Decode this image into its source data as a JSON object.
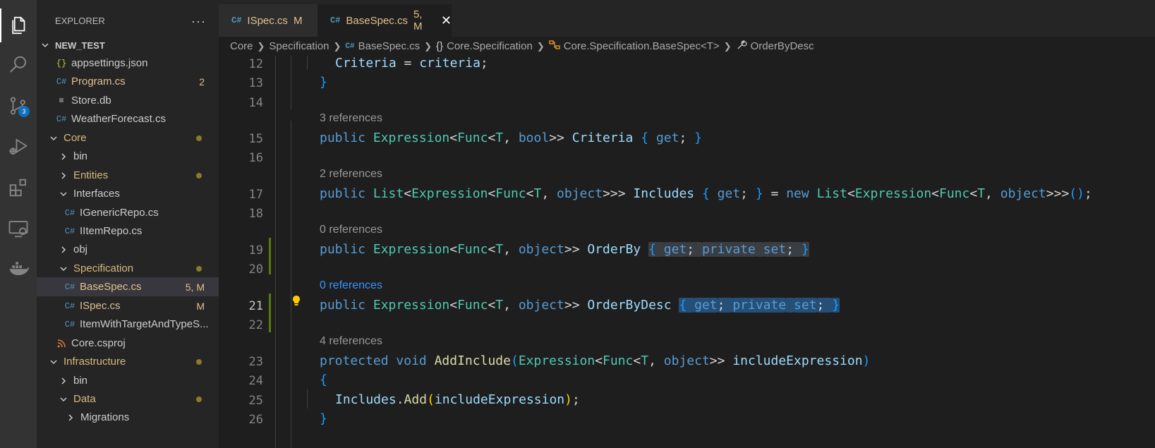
{
  "activity_bar": {
    "icons": [
      "files-icon",
      "search-icon",
      "source-control-icon",
      "run-debug-icon",
      "extensions-icon",
      "remote-explorer-icon",
      "docker-icon"
    ],
    "source_control_badge": "3"
  },
  "sidebar": {
    "title": "EXPLORER",
    "project": "NEW_TEST",
    "items": [
      {
        "label": "appsettings.json",
        "icon": "{}",
        "decoration": ""
      },
      {
        "label": "Program.cs",
        "icon": "C#",
        "decoration": "2"
      },
      {
        "label": "Store.db",
        "icon": "≡",
        "decoration": ""
      },
      {
        "label": "WeatherForecast.cs",
        "icon": "C#",
        "decoration": ""
      },
      {
        "label": "Core",
        "decoration": ""
      },
      {
        "label": "bin",
        "decoration": ""
      },
      {
        "label": "Entities",
        "decoration": ""
      },
      {
        "label": "Interfaces",
        "decoration": ""
      },
      {
        "label": "IGenericRepo.cs",
        "icon": "C#",
        "decoration": ""
      },
      {
        "label": "IItemRepo.cs",
        "icon": "C#",
        "decoration": ""
      },
      {
        "label": "obj",
        "decoration": ""
      },
      {
        "label": "Specification",
        "decoration": ""
      },
      {
        "label": "BaseSpec.cs",
        "icon": "C#",
        "decoration": "5, M"
      },
      {
        "label": "ISpec.cs",
        "icon": "C#",
        "decoration": "M"
      },
      {
        "label": "ItemWithTargetAndTypeS...",
        "icon": "C#",
        "decoration": ""
      },
      {
        "label": "Core.csproj",
        "icon": "rss",
        "decoration": ""
      },
      {
        "label": "Infrastructure",
        "decoration": ""
      },
      {
        "label": "bin",
        "decoration": ""
      },
      {
        "label": "Data",
        "decoration": ""
      },
      {
        "label": "Migrations",
        "decoration": ""
      }
    ]
  },
  "tabs": [
    {
      "label": "ISpec.cs",
      "state": "M"
    },
    {
      "label": "BaseSpec.cs",
      "state": "5, M",
      "close": "✕"
    }
  ],
  "breadcrumb": [
    "Core",
    "Specification",
    "BaseSpec.cs",
    "Core.Specification",
    "Core.Specification.BaseSpec<T>",
    "OrderByDesc"
  ],
  "editor": {
    "line_numbers": [
      "12",
      "13",
      "14",
      "15",
      "16",
      "17",
      "18",
      "19",
      "20",
      "21",
      "22",
      "23",
      "24",
      "25",
      "26"
    ],
    "codelens": [
      "3 references",
      "2 references",
      "0 references",
      "0 references",
      "4 references"
    ],
    "lines": [
      {
        "tokens": [
          [
            "id",
            "Criteria"
          ],
          [
            "pl",
            " = "
          ],
          [
            "id",
            "criteria"
          ],
          [
            "pl",
            ";"
          ]
        ]
      },
      {
        "tokens": [
          [
            "br3",
            "}"
          ]
        ]
      },
      {
        "tokens": []
      },
      {
        "tokens": [
          [
            "kw",
            "public"
          ],
          [
            "pl",
            " "
          ],
          [
            "ty",
            "Expression"
          ],
          [
            "pl",
            "<"
          ],
          [
            "ty",
            "Func"
          ],
          [
            "pl",
            "<"
          ],
          [
            "ty",
            "T"
          ],
          [
            "pl",
            ", "
          ],
          [
            "kw",
            "bool"
          ],
          [
            "pl",
            ">> "
          ],
          [
            "id",
            "Criteria"
          ],
          [
            "pl",
            " "
          ],
          [
            "br3",
            "{"
          ],
          [
            "pl",
            " "
          ],
          [
            "kw",
            "get"
          ],
          [
            "pl",
            "; "
          ],
          [
            "br3",
            "}"
          ]
        ]
      },
      {
        "tokens": []
      },
      {
        "tokens": [
          [
            "kw",
            "public"
          ],
          [
            "pl",
            " "
          ],
          [
            "ty",
            "List"
          ],
          [
            "pl",
            "<"
          ],
          [
            "ty",
            "Expression"
          ],
          [
            "pl",
            "<"
          ],
          [
            "ty",
            "Func"
          ],
          [
            "pl",
            "<"
          ],
          [
            "ty",
            "T"
          ],
          [
            "pl",
            ", "
          ],
          [
            "kw",
            "object"
          ],
          [
            "pl",
            ">>> "
          ],
          [
            "id",
            "Includes"
          ],
          [
            "pl",
            " "
          ],
          [
            "br3",
            "{"
          ],
          [
            "pl",
            " "
          ],
          [
            "kw",
            "get"
          ],
          [
            "pl",
            "; "
          ],
          [
            "br3",
            "}"
          ],
          [
            "pl",
            " = "
          ],
          [
            "kw",
            "new"
          ],
          [
            "pl",
            " "
          ],
          [
            "ty",
            "List"
          ],
          [
            "pl",
            "<"
          ],
          [
            "ty",
            "Expression"
          ],
          [
            "pl",
            "<"
          ],
          [
            "ty",
            "Func"
          ],
          [
            "pl",
            "<"
          ],
          [
            "ty",
            "T"
          ],
          [
            "pl",
            ", "
          ],
          [
            "kw",
            "object"
          ],
          [
            "pl",
            ">>>"
          ],
          [
            "br3",
            "()"
          ],
          [
            "pl",
            ";"
          ]
        ]
      },
      {
        "tokens": []
      },
      {
        "tokens": [
          [
            "kw",
            "public"
          ],
          [
            "pl",
            " "
          ],
          [
            "ty",
            "Expression"
          ],
          [
            "pl",
            "<"
          ],
          [
            "ty",
            "Func"
          ],
          [
            "pl",
            "<"
          ],
          [
            "ty",
            "T"
          ],
          [
            "pl",
            ", "
          ],
          [
            "kw",
            "object"
          ],
          [
            "pl",
            ">> "
          ],
          [
            "id",
            "OrderBy"
          ],
          [
            "pl",
            " "
          ],
          [
            "sel-br3",
            "{ "
          ],
          [
            "sel-kw",
            "get"
          ],
          [
            "sel-pl",
            "; "
          ],
          [
            "sel-kw",
            "private"
          ],
          [
            "sel-pl",
            " "
          ],
          [
            "sel-kw",
            "set"
          ],
          [
            "sel-pl",
            "; "
          ],
          [
            "sel-br3",
            "}"
          ]
        ]
      },
      {
        "tokens": []
      },
      {
        "tokens": [
          [
            "kw",
            "public"
          ],
          [
            "pl",
            " "
          ],
          [
            "ty",
            "Expression"
          ],
          [
            "pl",
            "<"
          ],
          [
            "ty",
            "Func"
          ],
          [
            "pl",
            "<"
          ],
          [
            "ty",
            "T"
          ],
          [
            "pl",
            ", "
          ],
          [
            "kw",
            "object"
          ],
          [
            "pl",
            ">> "
          ],
          [
            "id",
            "OrderByDesc"
          ],
          [
            "pl",
            " "
          ],
          [
            "sel2-br3",
            "{ "
          ],
          [
            "sel2-kw",
            "get"
          ],
          [
            "sel2-pl",
            "; "
          ],
          [
            "sel2-kw",
            "private"
          ],
          [
            "sel2-pl",
            " "
          ],
          [
            "sel2-kw",
            "set"
          ],
          [
            "sel2-pl",
            "; "
          ],
          [
            "sel2-br3",
            "}"
          ]
        ]
      },
      {
        "tokens": []
      },
      {
        "tokens": [
          [
            "kw",
            "protected"
          ],
          [
            "pl",
            " "
          ],
          [
            "kw",
            "void"
          ],
          [
            "pl",
            " "
          ],
          [
            "fn",
            "AddInclude"
          ],
          [
            "br3",
            "("
          ],
          [
            "ty",
            "Expression"
          ],
          [
            "pl",
            "<"
          ],
          [
            "ty",
            "Func"
          ],
          [
            "pl",
            "<"
          ],
          [
            "ty",
            "T"
          ],
          [
            "pl",
            ", "
          ],
          [
            "kw",
            "object"
          ],
          [
            "pl",
            ">> "
          ],
          [
            "id",
            "includeExpression"
          ],
          [
            "br3",
            ")"
          ]
        ]
      },
      {
        "tokens": [
          [
            "br3",
            "{"
          ]
        ]
      },
      {
        "tokens": [
          [
            "id",
            "Includes"
          ],
          [
            "pl",
            "."
          ],
          [
            "fn",
            "Add"
          ],
          [
            "br1",
            "("
          ],
          [
            "id",
            "includeExpression"
          ],
          [
            "br1",
            ")"
          ],
          [
            "pl",
            ";"
          ]
        ]
      },
      {
        "tokens": [
          [
            "br3",
            "}"
          ]
        ]
      }
    ]
  },
  "colors": {
    "activity_bar": "#333333",
    "sidebar": "#252526",
    "editor": "#1e1e1e",
    "accent": "#0e70c0",
    "modified": "#e2c08d",
    "git_added": "#587c0c"
  }
}
